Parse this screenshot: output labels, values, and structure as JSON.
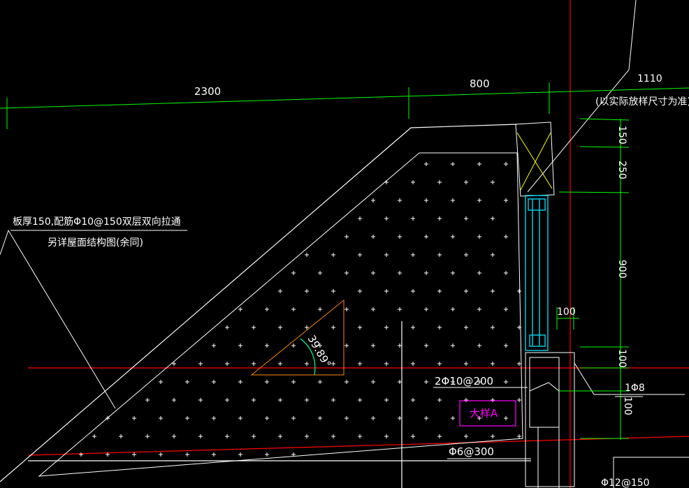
{
  "colors": {
    "background": "#000000",
    "outline": "#ffffff",
    "dimension": "#00ff00",
    "axis": "#ff0000",
    "window": "#00e5ff",
    "hatch": "#ffffff",
    "annotation": "#ffffff",
    "detail_tag": "#ff00ff",
    "angle_triangle": "#ff8800",
    "window_box_cross": "#ffff00"
  },
  "dimensions": {
    "top_2300": "2300",
    "top_800": "800",
    "top_1110": "1110",
    "top_note": "(以实际放样尺寸为准)",
    "v_150": "150",
    "v_250": "250",
    "v_900": "900",
    "v_100_bottom": "100",
    "v_100_last": "100",
    "h_100": "100"
  },
  "notes": {
    "slab_line1": "板厚150,配筋Φ10@150双层双向拉通",
    "slab_line2": "另详屋面结构图(余同)",
    "angle": "39.89°",
    "rebar_top": "2Φ10@200",
    "rebar_bottom": "Φ6@300",
    "rebar_right": "1Φ8",
    "rebar_corner": "Φ12@150",
    "detail_tag": "大样A"
  }
}
